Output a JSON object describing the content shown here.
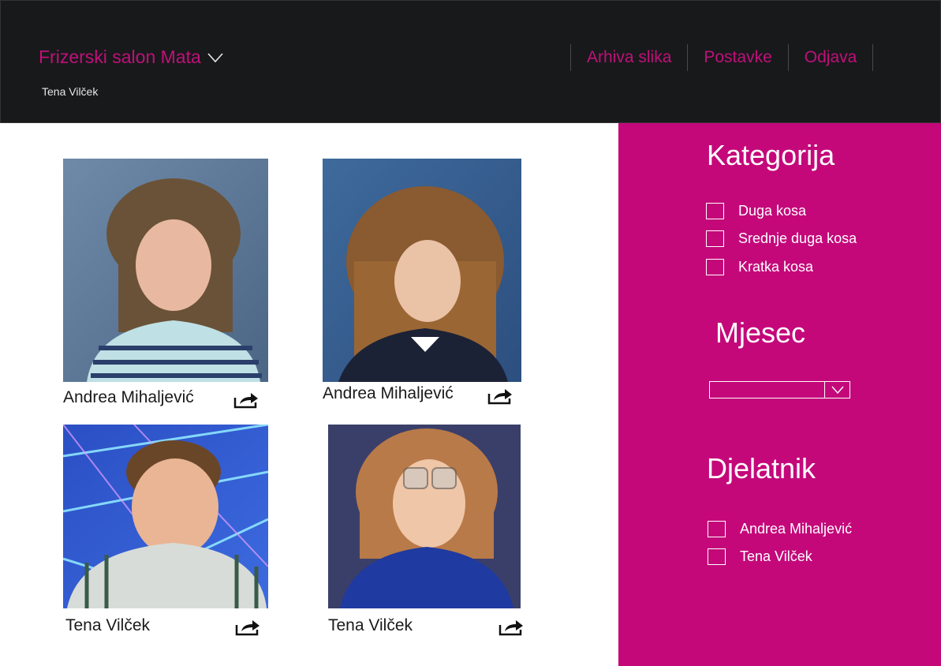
{
  "header": {
    "salon_name": "Frizerski salon Mata",
    "user_name": "Tena Vilček",
    "nav": [
      "Arhiva slika",
      "Postavke",
      "Odjava"
    ]
  },
  "gallery": [
    {
      "caption": "Andrea Mihaljević"
    },
    {
      "caption": "Andrea Mihaljević"
    },
    {
      "caption": "Tena Vilček"
    },
    {
      "caption": "Tena Vilček"
    }
  ],
  "sidebar": {
    "category_title": "Kategorija",
    "categories": [
      "Duga kosa",
      "Srednje duga kosa",
      "Kratka kosa"
    ],
    "month_title": "Mjesec",
    "month_value": "",
    "employee_title": "Djelatnik",
    "employees": [
      "Andrea Mihaljević",
      "Tena Vilček"
    ]
  },
  "colors": {
    "accent": "#c4087a",
    "header_bg": "#18191b"
  }
}
